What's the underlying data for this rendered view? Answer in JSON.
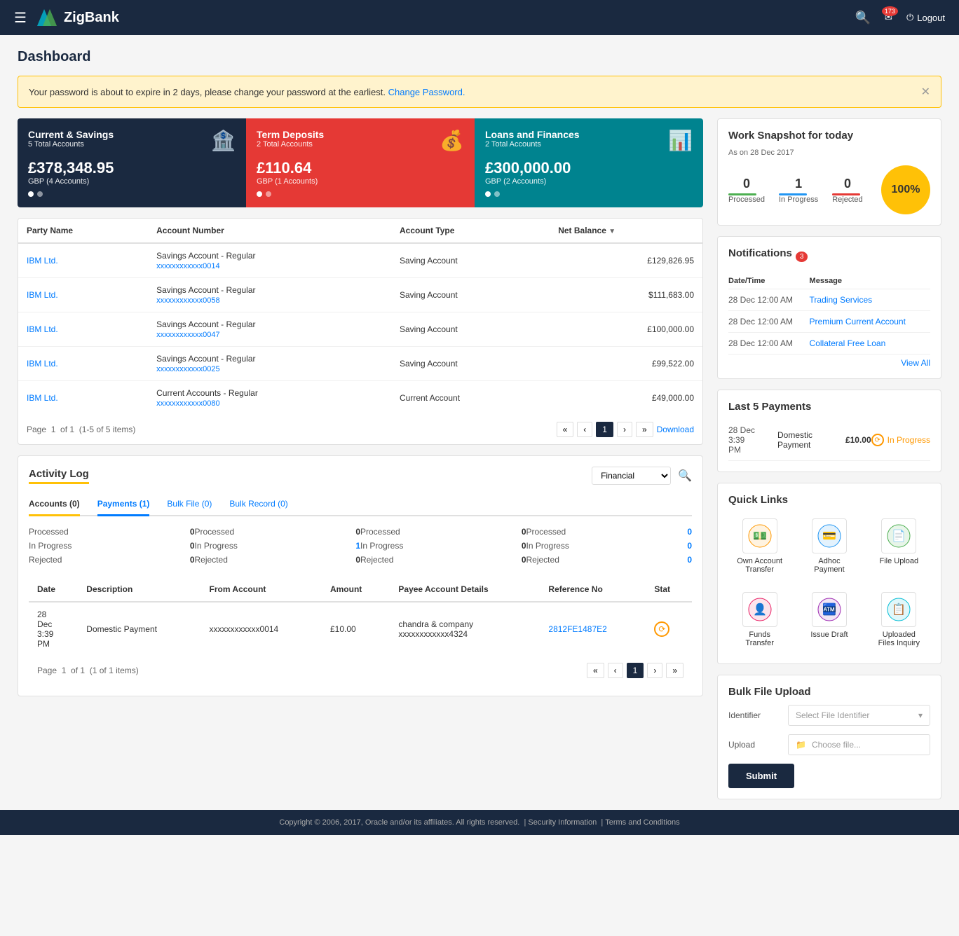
{
  "header": {
    "logo_text": "ZigBank",
    "notif_count": "173",
    "logout_label": "Logout"
  },
  "page": {
    "title": "Dashboard"
  },
  "alert": {
    "message": "Your password is about to expire in 2 days, please change your password at the earliest.",
    "link_text": "Change Password."
  },
  "account_cards": [
    {
      "title": "Current & Savings",
      "subtitle": "5 Total Accounts",
      "amount": "£378,348.95",
      "currency": "GBP (4 Accounts)",
      "icon": "🏦"
    },
    {
      "title": "Term Deposits",
      "subtitle": "2 Total Accounts",
      "amount": "£110.64",
      "currency": "GBP (1 Accounts)",
      "icon": "💰"
    },
    {
      "title": "Loans and Finances",
      "subtitle": "2 Total Accounts",
      "amount": "£300,000.00",
      "currency": "GBP (2 Accounts)",
      "icon": "📊"
    }
  ],
  "accounts_table": {
    "columns": [
      "Party Name",
      "Account Number",
      "Account Type",
      "Net Balance"
    ],
    "rows": [
      {
        "party": "IBM Ltd.",
        "acc_num": "Savings Account - Regular",
        "acc_num_id": "xxxxxxxxxxxx0014",
        "acc_type": "Saving Account",
        "balance": "£129,826.95"
      },
      {
        "party": "IBM Ltd.",
        "acc_num": "Savings Account - Regular",
        "acc_num_id": "xxxxxxxxxxxx0058",
        "acc_type": "Saving Account",
        "balance": "$111,683.00"
      },
      {
        "party": "IBM Ltd.",
        "acc_num": "Savings Account - Regular",
        "acc_num_id": "xxxxxxxxxxxx0047",
        "acc_type": "Saving Account",
        "balance": "£100,000.00"
      },
      {
        "party": "IBM Ltd.",
        "acc_num": "Savings Account - Regular",
        "acc_num_id": "xxxxxxxxxxxx0025",
        "acc_type": "Saving Account",
        "balance": "£99,522.00"
      },
      {
        "party": "IBM Ltd.",
        "acc_num": "Current Accounts - Regular",
        "acc_num_id": "xxxxxxxxxxxx0080",
        "acc_type": "Current Account",
        "balance": "£49,000.00"
      }
    ],
    "pagination": {
      "page_info": "Page  1  of 1  (1-5 of 5 items)",
      "download": "Download"
    }
  },
  "activity_log": {
    "title": "Activity Log",
    "filter": "Financial",
    "tabs": [
      {
        "label": "Accounts (0)",
        "type": "accounts"
      },
      {
        "label": "Payments (1)",
        "type": "payments"
      },
      {
        "label": "Bulk File (0)",
        "type": "bulk"
      },
      {
        "label": "Bulk Record (0)",
        "type": "bulkr"
      }
    ],
    "stats": [
      {
        "tab": "Accounts",
        "items": [
          {
            "label": "Processed",
            "value": "0"
          },
          {
            "label": "In Progress",
            "value": "0"
          },
          {
            "label": "Rejected",
            "value": "0"
          }
        ]
      },
      {
        "tab": "Payments",
        "items": [
          {
            "label": "Processed",
            "value": "0"
          },
          {
            "label": "In Progress",
            "value": "1"
          },
          {
            "label": "Rejected",
            "value": "0"
          }
        ]
      },
      {
        "tab": "Bulk File",
        "items": [
          {
            "label": "Processed",
            "value": "0"
          },
          {
            "label": "In Progress",
            "value": "0"
          },
          {
            "label": "Rejected",
            "value": "0"
          }
        ]
      },
      {
        "tab": "Bulk Record",
        "items": [
          {
            "label": "Processed",
            "value": "0"
          },
          {
            "label": "In Progress",
            "value": "0"
          },
          {
            "label": "Rejected",
            "value": "0"
          }
        ]
      }
    ],
    "table_columns": [
      "Date",
      "Description",
      "From Account",
      "Amount",
      "Payee Account Details",
      "Reference No",
      "Status"
    ],
    "table_rows": [
      {
        "date": "28 Dec 3:39 PM",
        "description": "Domestic Payment",
        "from_account": "xxxxxxxxxxxx0014",
        "amount": "£10.00",
        "payee": "chandra & company xxxxxxxxxxxx4324",
        "reference": "2812FE1487E2",
        "status": "in_progress"
      }
    ],
    "pagination": "Page  1  of 1  (1 of 1 items)"
  },
  "work_snapshot": {
    "title": "Work Snapshot for today",
    "date": "As on 28 Dec 2017",
    "processed": {
      "value": "0",
      "label": "Processed"
    },
    "in_progress": {
      "value": "1",
      "label": "In Progress"
    },
    "rejected": {
      "value": "0",
      "label": "Rejected"
    },
    "percentage": "100%"
  },
  "notifications": {
    "title": "Notifications",
    "count": "3",
    "col_date": "Date/Time",
    "col_message": "Message",
    "items": [
      {
        "date": "28 Dec 12:00 AM",
        "message": "Trading Services"
      },
      {
        "date": "28 Dec 12:00 AM",
        "message": "Premium Current Account"
      },
      {
        "date": "28 Dec 12:00 AM",
        "message": "Collateral Free Loan"
      }
    ],
    "view_all": "View All"
  },
  "last_payments": {
    "title": "Last 5 Payments",
    "items": [
      {
        "date": "28 Dec 3:39 PM",
        "description": "Domestic Payment",
        "amount": "£10.00",
        "status": "In Progress"
      }
    ]
  },
  "quick_links": {
    "title": "Quick Links",
    "items": [
      {
        "label": "Own Account Transfer",
        "icon": "💵"
      },
      {
        "label": "Adhoc Payment",
        "icon": "💳"
      },
      {
        "label": "File Upload",
        "icon": "📄"
      },
      {
        "label": "Funds Transfer",
        "icon": "👤"
      },
      {
        "label": "Issue Draft",
        "icon": "🏧"
      },
      {
        "label": "Uploaded Files Inquiry",
        "icon": "📋"
      }
    ]
  },
  "bulk_upload": {
    "title": "Bulk File Upload",
    "identifier_label": "Identifier",
    "identifier_placeholder": "Select File Identifier",
    "upload_label": "Upload",
    "upload_placeholder": "Choose file...",
    "submit_label": "Submit"
  },
  "footer": {
    "text": "Copyright © 2006, 2017, Oracle and/or its affiliates. All rights reserved.",
    "link1": "Security Information",
    "link2": "Terms and Conditions"
  }
}
